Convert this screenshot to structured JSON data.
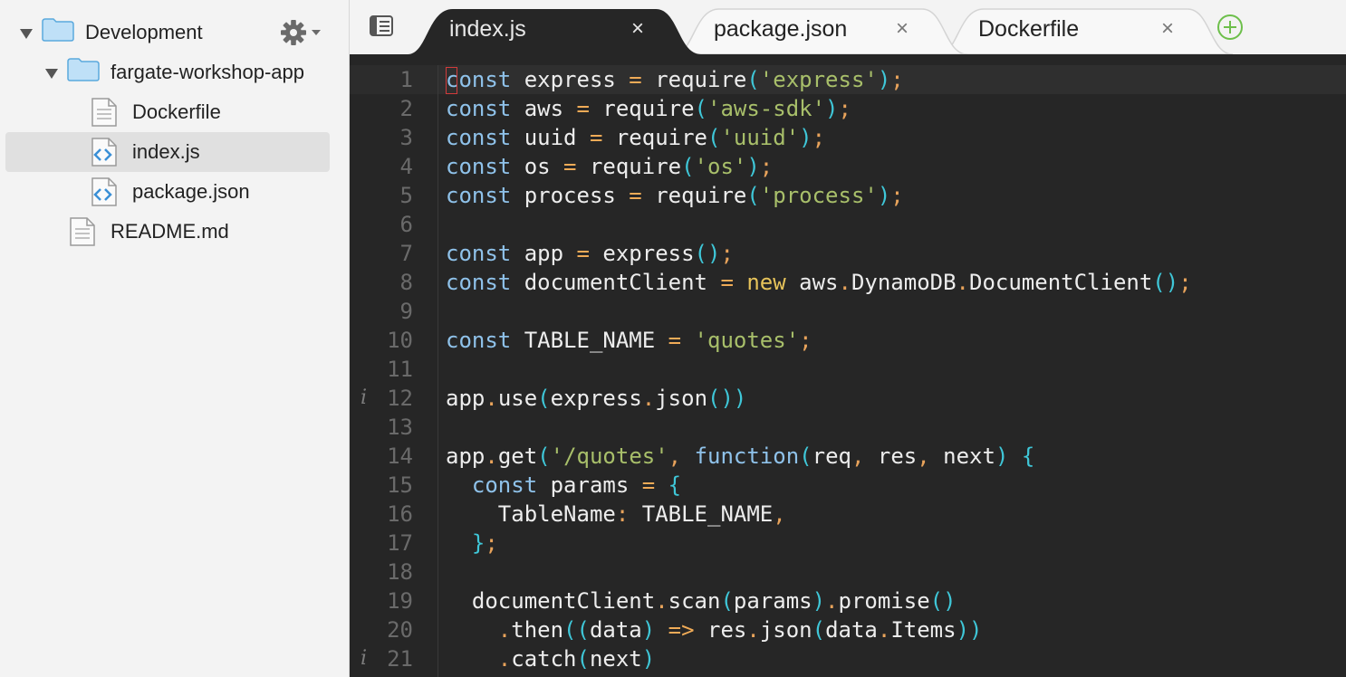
{
  "sidebar": {
    "root": {
      "label": "Development"
    },
    "project": {
      "label": "fargate-workshop-app"
    },
    "files": [
      {
        "label": "Dockerfile",
        "icon": "text-file-icon"
      },
      {
        "label": "index.js",
        "icon": "code-file-icon",
        "selected": true
      },
      {
        "label": "package.json",
        "icon": "code-file-icon"
      }
    ],
    "readme": {
      "label": "README.md",
      "icon": "text-file-icon"
    },
    "settings_icon": "gear-icon"
  },
  "tabs": [
    {
      "label": "index.js",
      "active": true,
      "close": "×"
    },
    {
      "label": "package.json",
      "active": false,
      "close": "×"
    },
    {
      "label": "Dockerfile",
      "active": false,
      "close": "×"
    }
  ],
  "editor": {
    "info_marker": "i",
    "lines": [
      {
        "n": "1",
        "tokens": [
          [
            "k",
            "const"
          ],
          [
            "i",
            " express "
          ],
          [
            "o",
            "="
          ],
          [
            "i",
            " require"
          ],
          [
            "p",
            "("
          ],
          [
            "s",
            "'express'"
          ],
          [
            "p",
            ")"
          ],
          [
            "d",
            ";"
          ]
        ]
      },
      {
        "n": "2",
        "tokens": [
          [
            "k",
            "const"
          ],
          [
            "i",
            " aws "
          ],
          [
            "o",
            "="
          ],
          [
            "i",
            " require"
          ],
          [
            "p",
            "("
          ],
          [
            "s",
            "'aws-sdk'"
          ],
          [
            "p",
            ")"
          ],
          [
            "d",
            ";"
          ]
        ]
      },
      {
        "n": "3",
        "tokens": [
          [
            "k",
            "const"
          ],
          [
            "i",
            " uuid "
          ],
          [
            "o",
            "="
          ],
          [
            "i",
            " require"
          ],
          [
            "p",
            "("
          ],
          [
            "s",
            "'uuid'"
          ],
          [
            "p",
            ")"
          ],
          [
            "d",
            ";"
          ]
        ]
      },
      {
        "n": "4",
        "tokens": [
          [
            "k",
            "const"
          ],
          [
            "i",
            " os "
          ],
          [
            "o",
            "="
          ],
          [
            "i",
            " require"
          ],
          [
            "p",
            "("
          ],
          [
            "s",
            "'os'"
          ],
          [
            "p",
            ")"
          ],
          [
            "d",
            ";"
          ]
        ]
      },
      {
        "n": "5",
        "tokens": [
          [
            "k",
            "const"
          ],
          [
            "i",
            " process "
          ],
          [
            "o",
            "="
          ],
          [
            "i",
            " require"
          ],
          [
            "p",
            "("
          ],
          [
            "s",
            "'process'"
          ],
          [
            "p",
            ")"
          ],
          [
            "d",
            ";"
          ]
        ]
      },
      {
        "n": "6",
        "tokens": []
      },
      {
        "n": "7",
        "tokens": [
          [
            "k",
            "const"
          ],
          [
            "i",
            " app "
          ],
          [
            "o",
            "="
          ],
          [
            "i",
            " express"
          ],
          [
            "p",
            "()"
          ],
          [
            "d",
            ";"
          ]
        ]
      },
      {
        "n": "8",
        "tokens": [
          [
            "k",
            "const"
          ],
          [
            "i",
            " documentClient "
          ],
          [
            "o",
            "="
          ],
          [
            "i",
            " "
          ],
          [
            "n",
            "new"
          ],
          [
            "i",
            " aws"
          ],
          [
            "d",
            "."
          ],
          [
            "i",
            "DynamoDB"
          ],
          [
            "d",
            "."
          ],
          [
            "i",
            "DocumentClient"
          ],
          [
            "p",
            "()"
          ],
          [
            "d",
            ";"
          ]
        ]
      },
      {
        "n": "9",
        "tokens": []
      },
      {
        "n": "10",
        "tokens": [
          [
            "k",
            "const"
          ],
          [
            "i",
            " TABLE_NAME "
          ],
          [
            "o",
            "="
          ],
          [
            "i",
            " "
          ],
          [
            "s",
            "'quotes'"
          ],
          [
            "d",
            ";"
          ]
        ]
      },
      {
        "n": "11",
        "tokens": []
      },
      {
        "n": "12",
        "info": true,
        "tokens": [
          [
            "i",
            "app"
          ],
          [
            "d",
            "."
          ],
          [
            "i",
            "use"
          ],
          [
            "p",
            "("
          ],
          [
            "i",
            "express"
          ],
          [
            "d",
            "."
          ],
          [
            "i",
            "json"
          ],
          [
            "p",
            "())"
          ]
        ]
      },
      {
        "n": "13",
        "tokens": []
      },
      {
        "n": "14",
        "tokens": [
          [
            "i",
            "app"
          ],
          [
            "d",
            "."
          ],
          [
            "i",
            "get"
          ],
          [
            "p",
            "("
          ],
          [
            "s",
            "'/quotes'"
          ],
          [
            "d",
            ","
          ],
          [
            "i",
            " "
          ],
          [
            "k",
            "function"
          ],
          [
            "p",
            "("
          ],
          [
            "i",
            "req"
          ],
          [
            "d",
            ","
          ],
          [
            "i",
            " res"
          ],
          [
            "d",
            ","
          ],
          [
            "i",
            " next"
          ],
          [
            "p",
            ")"
          ],
          [
            "i",
            " "
          ],
          [
            "p",
            "{"
          ]
        ]
      },
      {
        "n": "15",
        "tokens": [
          [
            "i",
            "  "
          ],
          [
            "k",
            "const"
          ],
          [
            "i",
            " params "
          ],
          [
            "o",
            "="
          ],
          [
            "i",
            " "
          ],
          [
            "p",
            "{"
          ]
        ]
      },
      {
        "n": "16",
        "tokens": [
          [
            "i",
            "    TableName"
          ],
          [
            "d",
            ":"
          ],
          [
            "i",
            " TABLE_NAME"
          ],
          [
            "d",
            ","
          ]
        ]
      },
      {
        "n": "17",
        "tokens": [
          [
            "i",
            "  "
          ],
          [
            "p",
            "}"
          ],
          [
            "d",
            ";"
          ]
        ]
      },
      {
        "n": "18",
        "tokens": []
      },
      {
        "n": "19",
        "tokens": [
          [
            "i",
            "  documentClient"
          ],
          [
            "d",
            "."
          ],
          [
            "i",
            "scan"
          ],
          [
            "p",
            "("
          ],
          [
            "i",
            "params"
          ],
          [
            "p",
            ")"
          ],
          [
            "d",
            "."
          ],
          [
            "i",
            "promise"
          ],
          [
            "p",
            "()"
          ]
        ]
      },
      {
        "n": "20",
        "tokens": [
          [
            "i",
            "    "
          ],
          [
            "d",
            "."
          ],
          [
            "i",
            "then"
          ],
          [
            "p",
            "(("
          ],
          [
            "i",
            "data"
          ],
          [
            "p",
            ")"
          ],
          [
            "i",
            " "
          ],
          [
            "o",
            "=>"
          ],
          [
            "i",
            " res"
          ],
          [
            "d",
            "."
          ],
          [
            "i",
            "json"
          ],
          [
            "p",
            "("
          ],
          [
            "i",
            "data"
          ],
          [
            "d",
            "."
          ],
          [
            "i",
            "Items"
          ],
          [
            "p",
            "))"
          ]
        ]
      },
      {
        "n": "21",
        "info": true,
        "tokens": [
          [
            "i",
            "    "
          ],
          [
            "d",
            "."
          ],
          [
            "i",
            "catch"
          ],
          [
            "p",
            "("
          ],
          [
            "i",
            "next"
          ],
          [
            "p",
            ")"
          ]
        ]
      }
    ]
  },
  "colors": {
    "editor_bg": "#262626",
    "keyword": "#8fc2ea",
    "string": "#a8bf6a",
    "operator": "#f0ab57",
    "paren": "#3fc7d8",
    "add_tab": "#6dbf4b"
  }
}
